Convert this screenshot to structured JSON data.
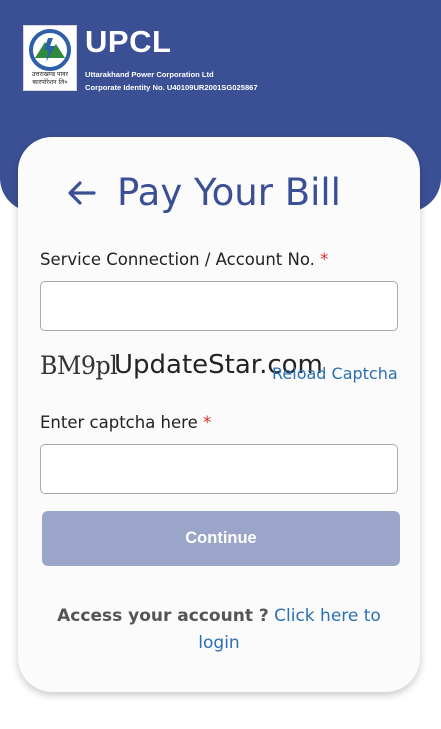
{
  "header": {
    "brand": "UPCL",
    "company_name": "Uttarakhand Power Corporation Ltd",
    "corporate_id": "Corporate Identity No. U40109UR2001SG025867",
    "logo_hindi_line1": "उत्तराखण्ड पावर",
    "logo_hindi_line2": "कारपोरेशन लि०",
    "colors": {
      "primary": "#3b5094",
      "link": "#2a6fb2",
      "required": "#d93025"
    }
  },
  "page": {
    "title": "Pay Your Bill",
    "back_icon": "arrow-left-icon"
  },
  "form": {
    "account_label": "Service Connection / Account No.",
    "account_value": "",
    "required_marker": "*",
    "captcha_text": "BM9pl",
    "watermark": "UpdateStar.com",
    "reload_captcha": "Reload Captcha",
    "captcha_label": "Enter captcha here",
    "captcha_value": "",
    "continue_label": "Continue"
  },
  "footer": {
    "access_text": "Access your account ?",
    "login_link": "Click here to login"
  }
}
